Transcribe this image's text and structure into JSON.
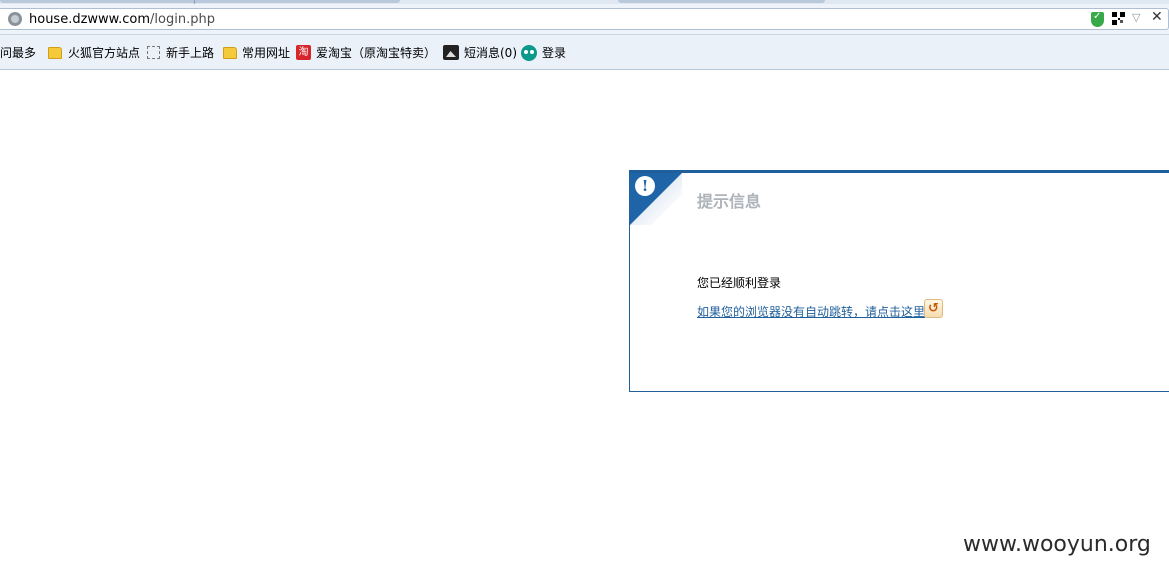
{
  "browser": {
    "address_bar": {
      "url_host": "house.dzwww.com",
      "url_path": "/login.php"
    },
    "bookmarks": [
      {
        "label": "访问最多",
        "icon": "none"
      },
      {
        "label": "火狐官方站点",
        "icon": "folder-icon"
      },
      {
        "label": "新手上路",
        "icon": "dotted-box-icon"
      },
      {
        "label": "常用网址",
        "icon": "folder-icon"
      },
      {
        "label": "爱淘宝（原淘宝特卖）",
        "icon": "taobao-icon",
        "icon_text": "淘"
      },
      {
        "label": "短消息(0)",
        "icon": "message-icon"
      },
      {
        "label": "登录",
        "icon": "owl-icon"
      }
    ]
  },
  "message_panel": {
    "title": "提示信息",
    "message": "您已经顺利登录",
    "redirect_link": "如果您的浏览器没有自动跳转，请点击这里",
    "accent_color": "#1e64a6"
  },
  "watermark": "www.wooyun.org"
}
